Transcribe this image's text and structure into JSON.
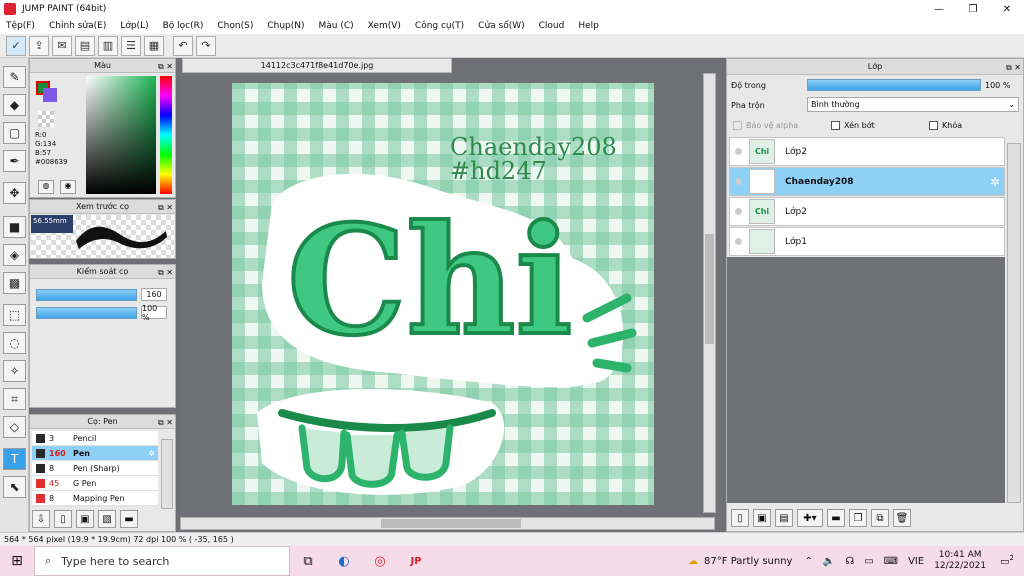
{
  "window": {
    "title": "JUMP PAINT (64bit)",
    "min": "—",
    "max": "❐",
    "close": "✕"
  },
  "menu": [
    "Tệp(F)",
    "Chỉnh sửa(E)",
    "Lớp(L)",
    "Bộ lọc(R)",
    "Chọn(S)",
    "Chụp(N)",
    "Màu (C)",
    "Xem(V)",
    "Công cụ(T)",
    "Cửa sổ(W)",
    "Cloud",
    "Help"
  ],
  "color_panel": {
    "title": "Màu",
    "r": "R:0",
    "g": "G:134",
    "b": "B:57",
    "hex": "#008639",
    "fg": "#1b8a3c",
    "bg": "#7f58e8"
  },
  "preview_panel": {
    "title": "Xem trước cọ",
    "size": "56.55mm"
  },
  "control_panel": {
    "title": "Kiểm soát cọ",
    "size_val": "160",
    "opacity_val": "100 %"
  },
  "brush_panel": {
    "title": "Cọ: Pen",
    "items": [
      {
        "size": "3",
        "name": "Pencil",
        "color": "#2a2a2a"
      },
      {
        "size": "160",
        "name": "Pen",
        "color": "#2a2a2a"
      },
      {
        "size": "8",
        "name": "Pen (Sharp)",
        "color": "#2a2a2a"
      },
      {
        "size": "45",
        "name": "G Pen",
        "color": "#e03030"
      },
      {
        "size": "8",
        "name": "Mapping Pen",
        "color": "#e03030"
      }
    ]
  },
  "document": {
    "tab": "14112c3c471f8e41d70e.jpg",
    "credit_line1": "Chaenday208",
    "credit_line2": "#hd247",
    "title_art": "Chi"
  },
  "layer_panel": {
    "title": "Lớp",
    "opacity_label": "Độ trong",
    "opacity_val": "100 %",
    "blend_label": "Pha trộn",
    "blend_val": "Bình thường",
    "protect_alpha": "Bảo vệ alpha",
    "clip": "Xén bớt",
    "lock": "Khóa",
    "layers": [
      {
        "name": "Lớp2",
        "thumb": "Chi"
      },
      {
        "name": "Chaenday208",
        "thumb": ""
      },
      {
        "name": "Lớp2",
        "thumb": "Chi"
      },
      {
        "name": "Lớp1",
        "thumb": ""
      }
    ]
  },
  "status": "564 * 564 pixel  (19.9 * 19.9cm)  72 dpi  100 %  ( -35, 165 )",
  "taskbar": {
    "search_placeholder": "Type here to search",
    "weather": "87°F  Partly sunny",
    "lang": "VIE",
    "time": "10:41 AM",
    "date": "12/22/2021",
    "notif": "2"
  },
  "colors": {
    "accent": "#3aa0e8",
    "green": "#2db36b"
  }
}
